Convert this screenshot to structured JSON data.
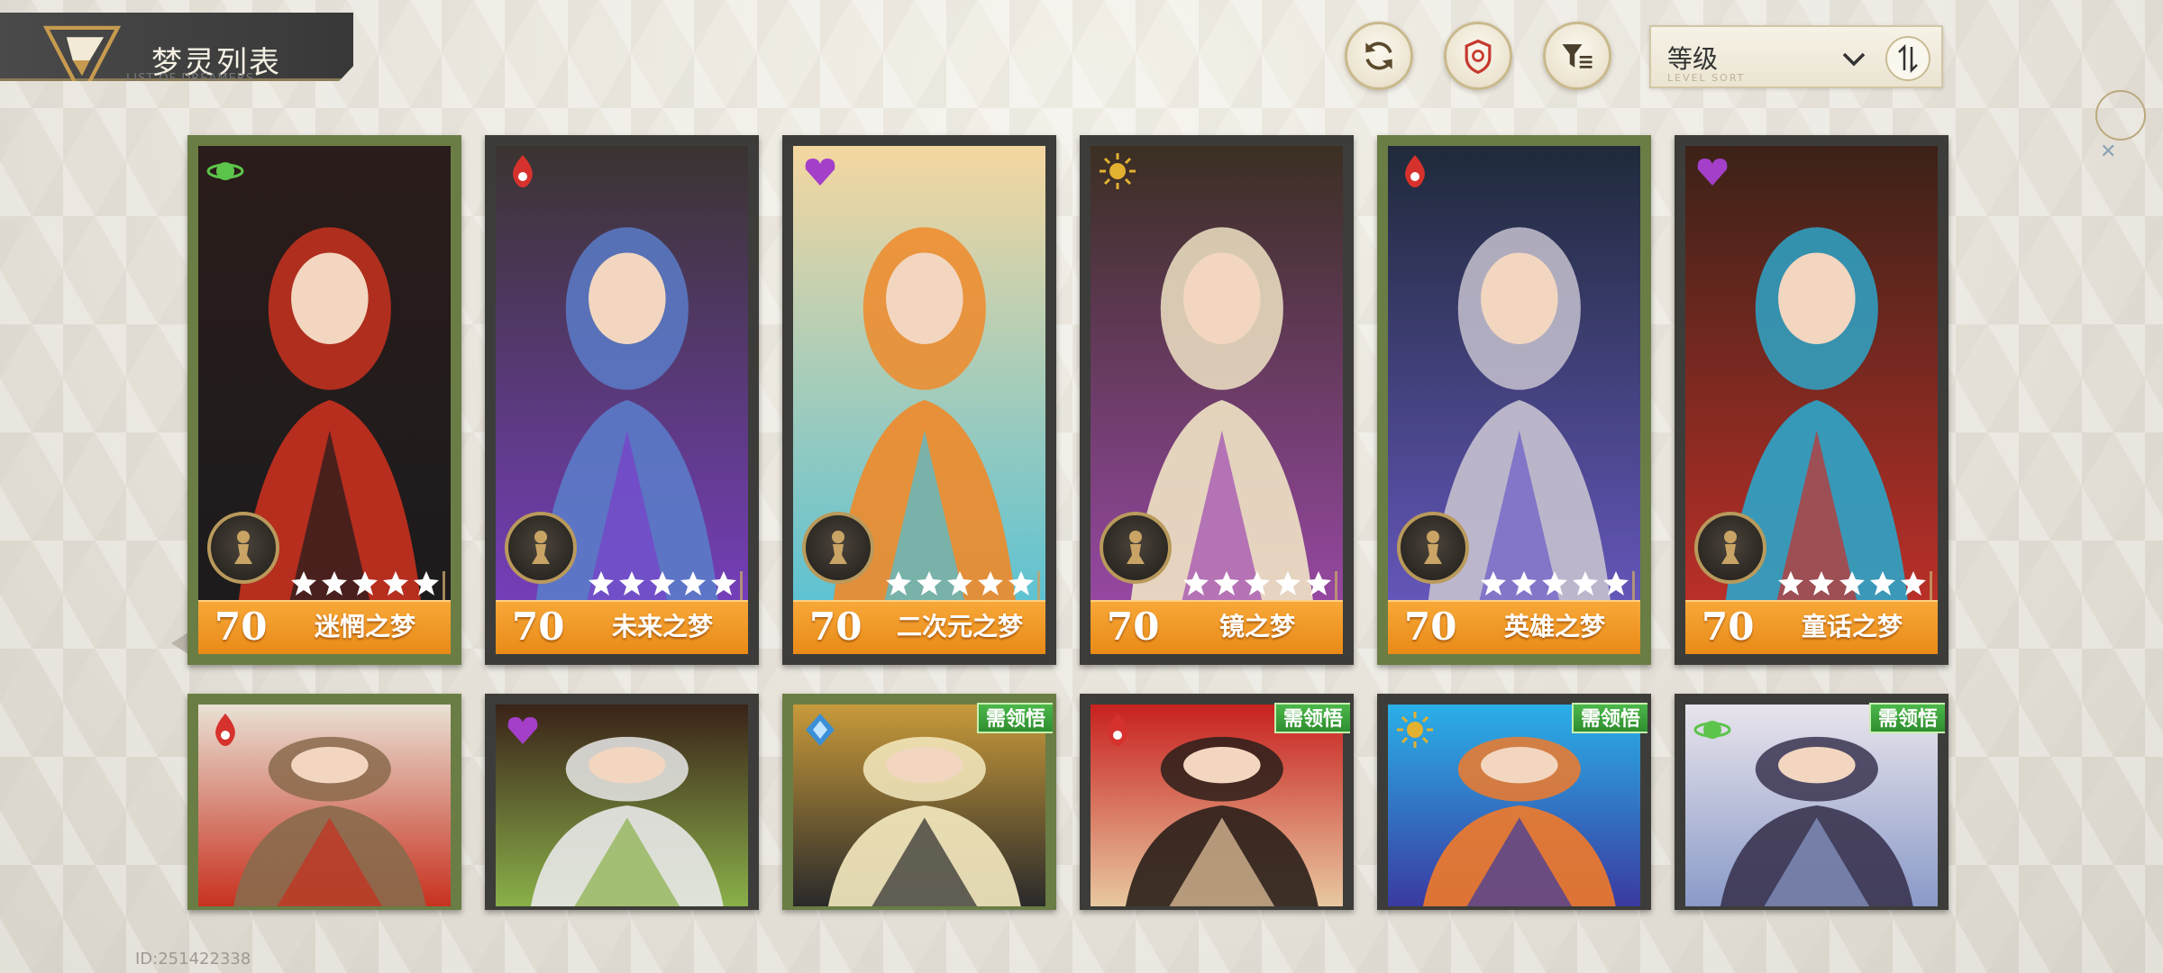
{
  "header": {
    "title": "梦灵列表",
    "subtitle": "LIST OF DREAMERS"
  },
  "toolbar": {
    "refresh_icon": "refresh-icon",
    "badge_icon": "shield-icon",
    "filter_icon": "filter-icon",
    "sort_label": "等级",
    "sort_sublabel": "LEVEL SORT",
    "accent": "#c9b98d"
  },
  "cards": [
    {
      "level": "70",
      "name": "迷惘之梦",
      "stars": 5,
      "element": "green-orb",
      "element_color": "#5cc44a",
      "frame": "green"
    },
    {
      "level": "70",
      "name": "未来之梦",
      "stars": 5,
      "element": "red-drop",
      "element_color": "#d6322d",
      "frame": "dark"
    },
    {
      "level": "70",
      "name": "二次元之梦",
      "stars": 5,
      "element": "purple-heart",
      "element_color": "#a43fc9",
      "frame": "dark"
    },
    {
      "level": "70",
      "name": "镜之梦",
      "stars": 5,
      "element": "gold-sun",
      "element_color": "#e2b130",
      "frame": "dark"
    },
    {
      "level": "70",
      "name": "英雄之梦",
      "stars": 5,
      "element": "red-drop",
      "element_color": "#d6322d",
      "frame": "green"
    },
    {
      "level": "70",
      "name": "童话之梦",
      "stars": 5,
      "element": "purple-heart",
      "element_color": "#a43fc9",
      "frame": "dark"
    }
  ],
  "row2": [
    {
      "element": "red-drop",
      "element_color": "#d6322d",
      "frame": "green",
      "badge": ""
    },
    {
      "element": "purple-heart",
      "element_color": "#a43fc9",
      "frame": "dark",
      "badge": ""
    },
    {
      "element": "blue-crystal",
      "element_color": "#3b8fd6",
      "frame": "green",
      "badge": "需领悟"
    },
    {
      "element": "red-drop",
      "element_color": "#d6322d",
      "frame": "dark",
      "badge": "需领悟"
    },
    {
      "element": "gold-sun",
      "element_color": "#e2b130",
      "frame": "dark",
      "badge": "需领悟"
    },
    {
      "element": "green-orb",
      "element_color": "#5cc44a",
      "frame": "dark",
      "badge": "需领悟"
    }
  ],
  "footer": {
    "player_id": "ID:251422338"
  }
}
